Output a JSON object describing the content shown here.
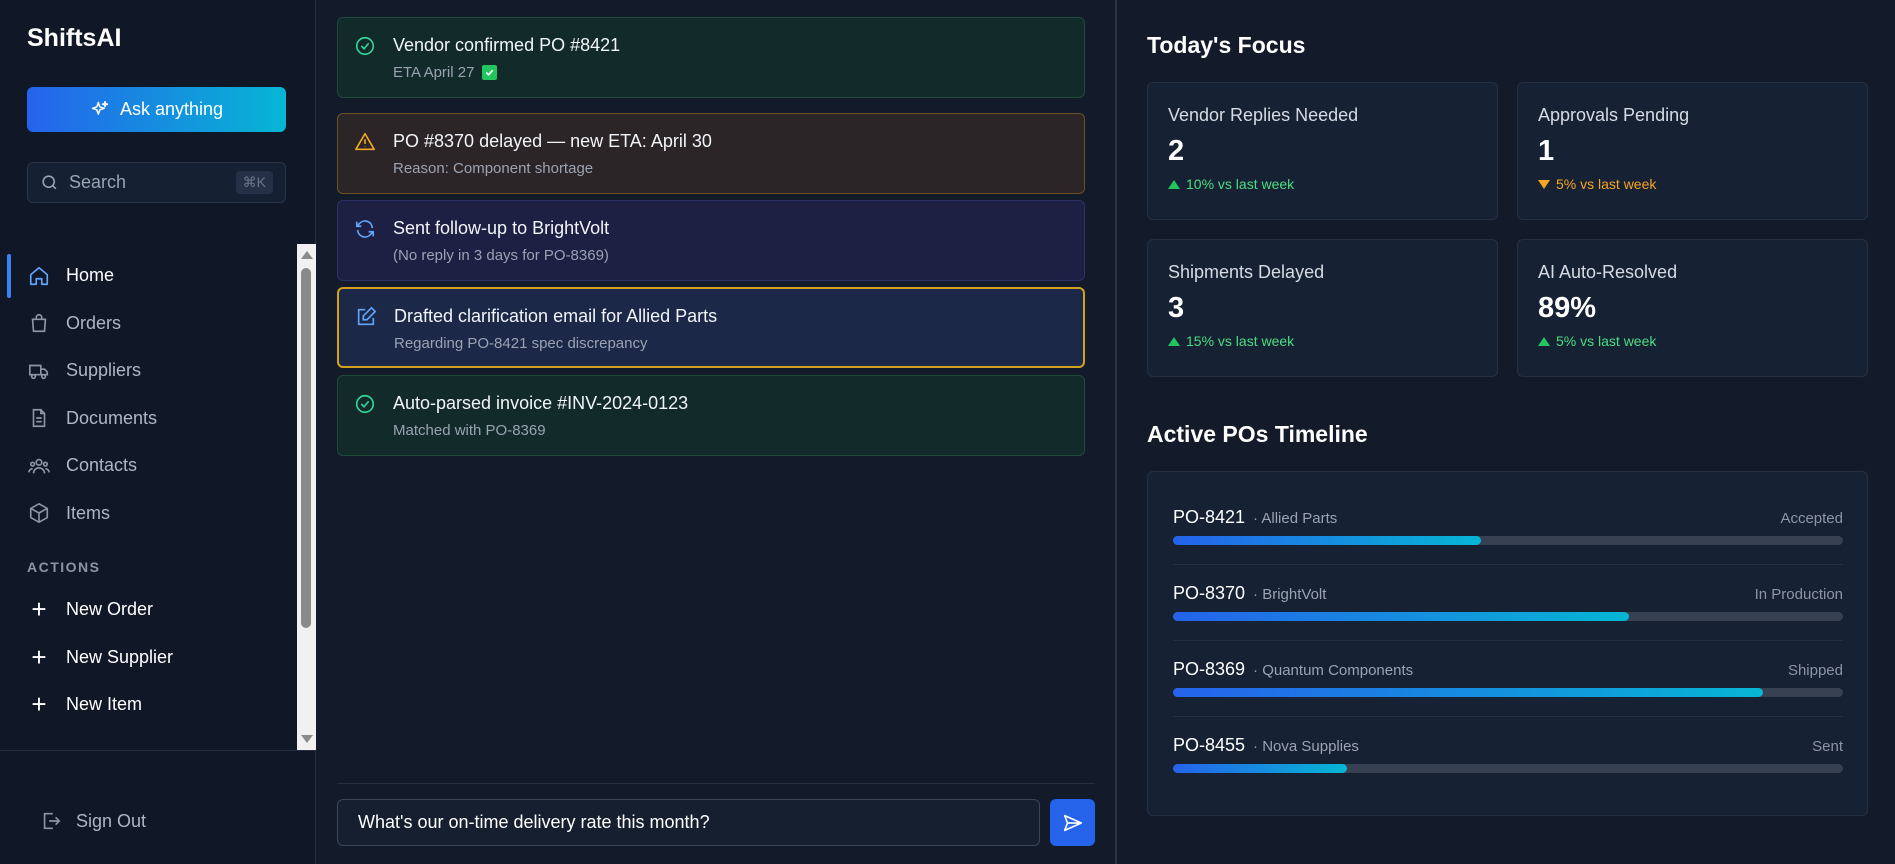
{
  "app": {
    "brand": "ShiftsAI"
  },
  "sidebar": {
    "ask_label": "Ask anything",
    "search_placeholder": "Search",
    "search_shortcut": "⌘K",
    "nav": [
      {
        "label": "Home",
        "icon": "home-icon"
      },
      {
        "label": "Orders",
        "icon": "shopping-bag-icon"
      },
      {
        "label": "Suppliers",
        "icon": "truck-icon"
      },
      {
        "label": "Documents",
        "icon": "document-icon"
      },
      {
        "label": "Contacts",
        "icon": "users-icon"
      },
      {
        "label": "Items",
        "icon": "box-icon"
      }
    ],
    "actions_heading": "ACTIONS",
    "actions": [
      {
        "label": "New Order"
      },
      {
        "label": "New Supplier"
      },
      {
        "label": "New Item"
      }
    ],
    "sign_out": "Sign Out"
  },
  "feed": [
    {
      "title": "Vendor confirmed PO #8421",
      "sub": "ETA April 27",
      "icon": "check-circle-icon",
      "tone": "green"
    },
    {
      "title": "PO #8370 delayed — new ETA: April 30",
      "sub": "Reason: Component shortage",
      "icon": "warning-icon",
      "tone": "amber"
    },
    {
      "title": "Sent follow-up to BrightVolt",
      "sub": "(No reply in 3 days for PO-8369)",
      "icon": "refresh-icon",
      "tone": "indigo"
    },
    {
      "title": "Drafted clarification email for Allied Parts",
      "sub": "Regarding PO-8421 spec discrepancy",
      "icon": "edit-icon",
      "tone": "blue"
    },
    {
      "title": "Auto-parsed invoice #INV-2024-0123",
      "sub": "Matched with PO-8369",
      "icon": "check-circle-icon",
      "tone": "green"
    }
  ],
  "composer": {
    "value": "What's our on-time delivery rate this month?"
  },
  "focus": {
    "heading": "Today's Focus",
    "stats": [
      {
        "label": "Vendor Replies Needed",
        "value": "2",
        "delta": "10% vs last week",
        "direction": "up",
        "color": "#4ade80"
      },
      {
        "label": "Approvals Pending",
        "value": "1",
        "delta": "5% vs last week",
        "direction": "down",
        "color": "#f5a623"
      },
      {
        "label": "Shipments Delayed",
        "value": "3",
        "delta": "15% vs last week",
        "direction": "up",
        "color": "#4ade80"
      },
      {
        "label": "AI Auto-Resolved",
        "value": "89%",
        "delta": "5% vs last week",
        "direction": "up",
        "color": "#4ade80"
      }
    ]
  },
  "timeline": {
    "heading": "Active POs Timeline",
    "rows": [
      {
        "id": "PO-8421",
        "vendor": "· Allied Parts",
        "status": "Accepted",
        "progress": 0.46
      },
      {
        "id": "PO-8370",
        "vendor": "· BrightVolt",
        "status": "In Production",
        "progress": 0.68
      },
      {
        "id": "PO-8369",
        "vendor": "· Quantum Components",
        "status": "Shipped",
        "progress": 0.88
      },
      {
        "id": "PO-8455",
        "vendor": "· Nova Supplies",
        "status": "Sent",
        "progress": 0.26
      }
    ]
  },
  "colors": {
    "accent": "#2563eb",
    "accent2": "#06b6d4",
    "background": "#131a2a"
  }
}
